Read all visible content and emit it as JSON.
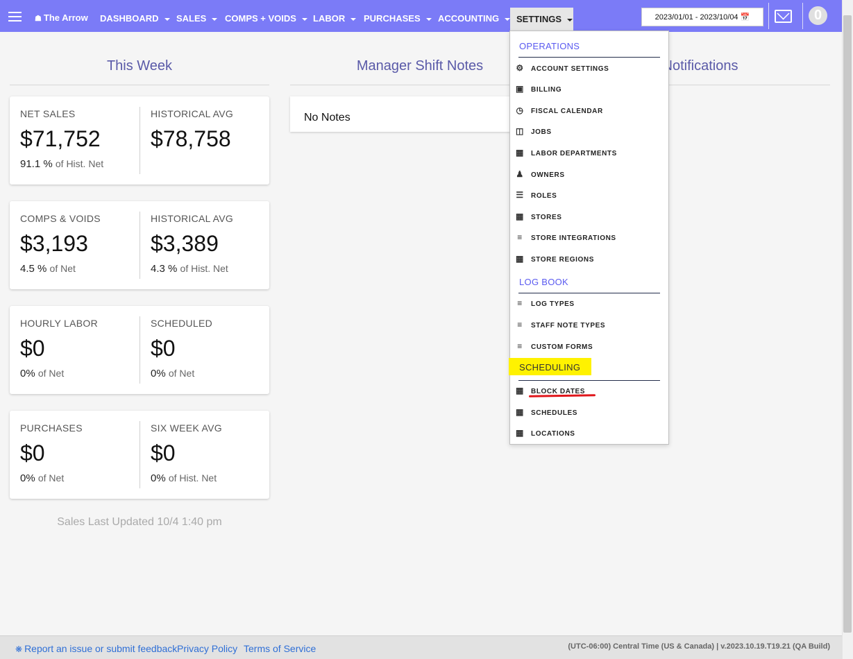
{
  "nav": {
    "brand": "The Arrow",
    "items": [
      {
        "label": "DASHBOARD"
      },
      {
        "label": "SALES"
      },
      {
        "label": "COMPS + VOIDS"
      },
      {
        "label": "LABOR"
      },
      {
        "label": "PURCHASES"
      },
      {
        "label": "ACCOUNTING"
      }
    ],
    "settings_label": "SETTINGS",
    "date_range": "2023/01/01 - 2023/10/04",
    "badge_count": "0"
  },
  "columns": {
    "this_week": "This Week",
    "manager_notes": "Manager Shift Notes",
    "notifications": "Notifications"
  },
  "cards": [
    {
      "left": {
        "label": "NET SALES",
        "value": "$71,752",
        "pct": "91.1 %",
        "suffix": "of Hist. Net"
      },
      "right": {
        "label": "HISTORICAL AVG",
        "value": "$78,758",
        "pct": "",
        "suffix": ""
      }
    },
    {
      "left": {
        "label": "COMPS & VOIDS",
        "value": "$3,193",
        "pct": "4.5 %",
        "suffix": "of Net"
      },
      "right": {
        "label": "HISTORICAL AVG",
        "value": "$3,389",
        "pct": "4.3 %",
        "suffix": "of Hist. Net"
      }
    },
    {
      "left": {
        "label": "HOURLY LABOR",
        "value": "$0",
        "pct": "0%",
        "suffix": "of Net"
      },
      "right": {
        "label": "SCHEDULED",
        "value": "$0",
        "pct": "0%",
        "suffix": "of Net"
      }
    },
    {
      "left": {
        "label": "PURCHASES",
        "value": "$0",
        "pct": "0%",
        "suffix": "of Net"
      },
      "right": {
        "label": "SIX WEEK AVG",
        "value": "$0",
        "pct": "0%",
        "suffix": "of Hist. Net"
      }
    }
  ],
  "sales_updated": "Sales Last Updated 10/4 1:40 pm",
  "notes": {
    "empty": "No Notes"
  },
  "settings_menu": {
    "operations_header": "OPERATIONS",
    "operations": [
      {
        "label": "ACCOUNT SETTINGS",
        "icon": "cogs-icon"
      },
      {
        "label": "BILLING",
        "icon": "money-bill-icon"
      },
      {
        "label": "FISCAL CALENDAR",
        "icon": "clock-icon"
      },
      {
        "label": "JOBS",
        "icon": "map-icon"
      },
      {
        "label": "LABOR DEPARTMENTS",
        "icon": "building-icon"
      },
      {
        "label": "OWNERS",
        "icon": "users-icon"
      },
      {
        "label": "ROLES",
        "icon": "list-icon"
      },
      {
        "label": "STORES",
        "icon": "building-icon"
      },
      {
        "label": "STORE INTEGRATIONS",
        "icon": "sliders-icon"
      },
      {
        "label": "STORE REGIONS",
        "icon": "building-icon"
      }
    ],
    "logbook_header": "LOG BOOK",
    "logbook": [
      {
        "label": "LOG TYPES",
        "icon": "sliders-icon"
      },
      {
        "label": "STAFF NOTE TYPES",
        "icon": "sliders-icon"
      },
      {
        "label": "CUSTOM FORMS",
        "icon": "sliders-icon"
      }
    ],
    "scheduling_header": "SCHEDULING",
    "scheduling": [
      {
        "label": "BLOCK DATES",
        "icon": "calendar-icon"
      },
      {
        "label": "SCHEDULES",
        "icon": "calendar-icon"
      },
      {
        "label": "LOCATIONS",
        "icon": "calendar-icon"
      }
    ]
  },
  "footer": {
    "report": "Report an issue or submit feedback",
    "privacy": "Privacy Policy",
    "terms": "Terms of Service",
    "version": "(UTC-06:00) Central Time (US & Canada) | v.2023.10.19.T19.21 (QA Build)"
  },
  "colors": {
    "nav_bg": "#7b7bf7",
    "title": "#5a5aa8",
    "link": "#2f6fd6",
    "highlight": "#fff200",
    "underline": "#e0161b"
  }
}
